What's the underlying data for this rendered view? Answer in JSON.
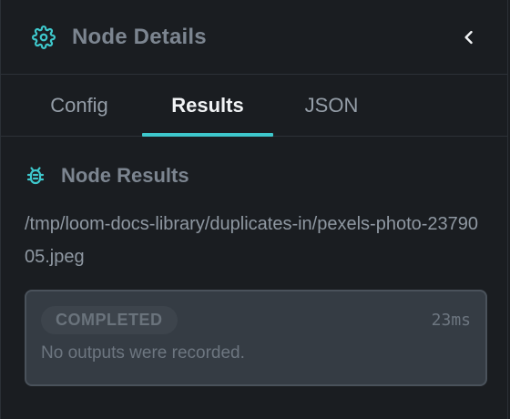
{
  "header": {
    "title": "Node Details",
    "settings_icon": "gear-icon",
    "back_icon": "chevron-left-icon",
    "accent_color": "#3ec8cc"
  },
  "tabs": [
    {
      "label": "Config",
      "active": false
    },
    {
      "label": "Results",
      "active": true
    },
    {
      "label": "JSON",
      "active": false
    }
  ],
  "results": {
    "section_title": "Node Results",
    "section_icon": "bug-icon",
    "file_path": "/tmp/loom-docs-library/duplicates-in/pexels-photo-2379005.jpeg",
    "status": "COMPLETED",
    "duration": "23ms",
    "message": "No outputs were recorded."
  }
}
